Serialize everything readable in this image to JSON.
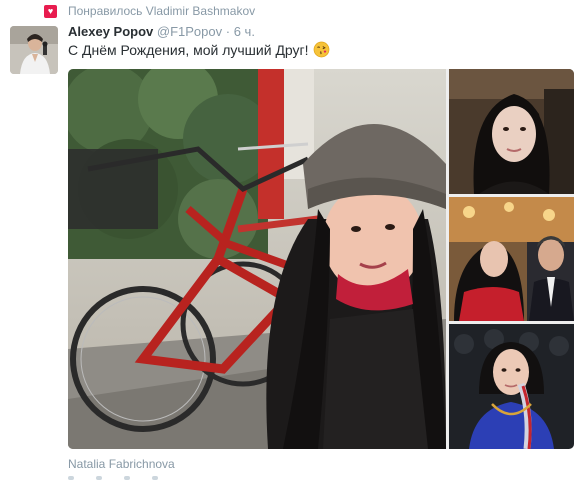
{
  "retweet_context": {
    "icon": "heart-icon",
    "text": "Понравилось Vladimir Bashmakov",
    "accent_color": "#e81c4f"
  },
  "tweet": {
    "author_name": "Alexey Popov",
    "author_handle": "@F1Popov",
    "separator": "·",
    "time": "6 ч.",
    "text": "С Днём Рождения, мой лучший Друг!",
    "emoji": "kissing-face-emoji"
  },
  "media": {
    "photos": [
      {
        "name": "selfie-with-bicycles"
      },
      {
        "name": "portrait-indoor"
      },
      {
        "name": "photo-with-man"
      },
      {
        "name": "portrait-braid"
      }
    ],
    "tagged_user": "Natalia Fabrichnova"
  },
  "colors": {
    "text_primary": "#292f33",
    "text_secondary": "#8899a6"
  }
}
